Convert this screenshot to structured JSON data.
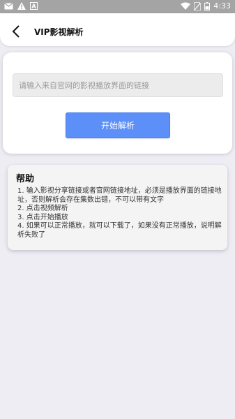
{
  "status_bar": {
    "time": "4:33",
    "icons": [
      "mail-icon",
      "warning-icon",
      "a-icon",
      "wifi-icon",
      "no-sim-icon",
      "battery-icon"
    ]
  },
  "app_bar": {
    "back_icon": "back-arrow-icon",
    "title": "VIP影视解析"
  },
  "parse_card": {
    "url_placeholder": "请输入来自官网的影视播放界面的链接",
    "url_value": "",
    "start_button": "开始解析"
  },
  "help_card": {
    "title": "帮助",
    "items": [
      "1. 输入影视分享链接或者官网链接地址，必须是播放界面的链接地址，否则解析会存在集数出错，不可以带有文字",
      "2. 点击视频解析",
      "3. 点击开始播放",
      "4. 如果可以正常播放，就可以下载了，如果没有正常播放，说明解析失败了"
    ]
  },
  "colors": {
    "status_bar": "#a4a4a4",
    "background": "#eeedf3",
    "accent_button": "#5c8ff8"
  }
}
